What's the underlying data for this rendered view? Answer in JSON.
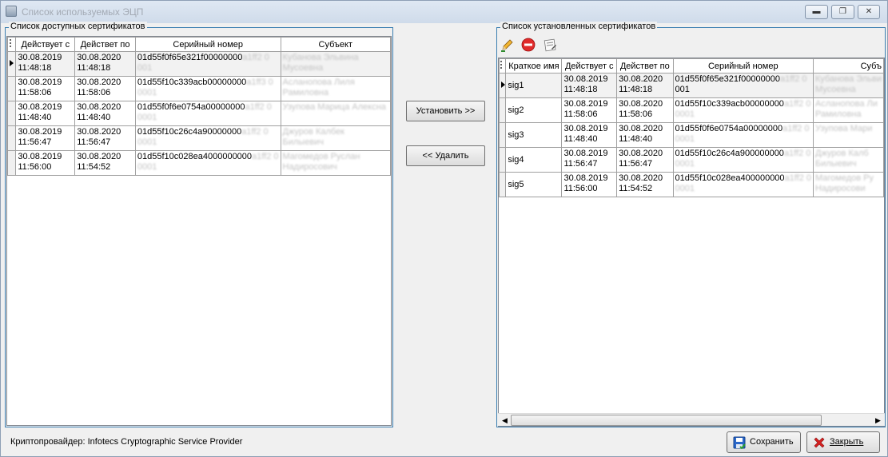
{
  "window": {
    "title": "Список используемых ЭЦП",
    "minimize_glyph": "▬",
    "maximize_glyph": "❐",
    "close_glyph": "✕"
  },
  "available": {
    "group_title": "Список доступных сертификатов",
    "columns": [
      "Действует с",
      "Действет по",
      "Серийный номер",
      "Субъект"
    ],
    "rows": [
      {
        "from_date": "30.08.2019",
        "from_time": "11:48:18",
        "to_date": "30.08.2020",
        "to_time": "11:48:18",
        "serial_1": "01d55f0f65e321f00000000",
        "serial_1b": "a1ff2 0",
        "serial_2": "001",
        "subject_1": "Кубанова Эльвина",
        "subject_2": "Мусоевна"
      },
      {
        "from_date": "30.08.2019",
        "from_time": "11:58:06",
        "to_date": "30.08.2020",
        "to_time": "11:58:06",
        "serial_1": "01d55f10c339acb00000000",
        "serial_1b": "a1ff3 0",
        "serial_2": "0001",
        "subject_1": "Асланопова Лиля",
        "subject_2": "Рамиловна"
      },
      {
        "from_date": "30.08.2019",
        "from_time": "11:48:40",
        "to_date": "30.08.2020",
        "to_time": "11:48:40",
        "serial_1": "01d55f0f6e0754a00000000",
        "serial_1b": "a1ff2 0",
        "serial_2": "0001",
        "subject_1": "Узупова Марица Алексна",
        "subject_2": ""
      },
      {
        "from_date": "30.08.2019",
        "from_time": "11:56:47",
        "to_date": "30.08.2020",
        "to_time": "11:56:47",
        "serial_1": "01d55f10c26c4a90000000",
        "serial_1b": "a1ff2 0",
        "serial_2": "0001",
        "subject_1": "Джуров Калбек",
        "subject_2": "Билыевич"
      },
      {
        "from_date": "30.08.2019",
        "from_time": "11:56:00",
        "to_date": "30.08.2020",
        "to_time": "11:54:52",
        "serial_1": "01d55f10c028ea4000000000",
        "serial_1b": "a1ff2 0",
        "serial_2": "0001",
        "subject_1": "Магомедов Руслан",
        "subject_2": "Надиросович"
      }
    ]
  },
  "actions": {
    "install_label": "Установить >>",
    "remove_label": "<< Удалить"
  },
  "installed": {
    "group_title": "Список установленных сертификатов",
    "columns": [
      "Краткое имя",
      "Действует с",
      "Действет по",
      "Серийный номер",
      "Субъ"
    ],
    "rows": [
      {
        "name": "sig1",
        "from_date": "30.08.2019",
        "from_time": "11:48:18",
        "to_date": "30.08.2020",
        "to_time": "11:48:18",
        "serial_1": "01d55f0f65e321f00000000",
        "serial_1b": "a1ff2 0",
        "serial_2": "001",
        "subject_1": "Кубанова Эльви",
        "subject_2": "Мусоевна"
      },
      {
        "name": "sig2",
        "from_date": "30.08.2019",
        "from_time": "11:58:06",
        "to_date": "30.08.2020",
        "to_time": "11:58:06",
        "serial_1": "01d55f10c339acb00000000",
        "serial_1b": "a1ff2 0",
        "serial_2": "0001",
        "subject_1": "Асланопова Ли",
        "subject_2": "Рамиловна"
      },
      {
        "name": "sig3",
        "from_date": "30.08.2019",
        "from_time": "11:48:40",
        "to_date": "30.08.2020",
        "to_time": "11:48:40",
        "serial_1": "01d55f0f6e0754a00000000",
        "serial_1b": "a1ff2 0",
        "serial_2": "0001",
        "subject_1": "Узупова Мари",
        "subject_2": ""
      },
      {
        "name": "sig4",
        "from_date": "30.08.2019",
        "from_time": "11:56:47",
        "to_date": "30.08.2020",
        "to_time": "11:56:47",
        "serial_1": "01d55f10c26c4a900000000",
        "serial_1b": "a1ff2 0",
        "serial_2": "0001",
        "subject_1": "Джуров Калб",
        "subject_2": "Билыевич"
      },
      {
        "name": "sig5",
        "from_date": "30.08.2019",
        "from_time": "11:56:00",
        "to_date": "30.08.2020",
        "to_time": "11:54:52",
        "serial_1": "01d55f10c028ea400000000",
        "serial_1b": "a1ff2 0",
        "serial_2": "0001",
        "subject_1": "Магомедов Ру",
        "subject_2": "Надиросови"
      }
    ],
    "toolbar_icons": [
      "edit-pencil-icon",
      "remove-circle-icon",
      "properties-notepad-icon"
    ]
  },
  "footer": {
    "crypto_provider": "Криптопровайдер: Infotecs Cryptographic Service Provider",
    "save_label": "Сохранить",
    "close_label": "Закрыть"
  },
  "colors": {
    "group_border": "#3c7fb1",
    "window_bg": "#f0f0f0",
    "remove_icon": "#e02b2b",
    "close_icon": "#d62020",
    "save_icon": "#2a67c9"
  }
}
